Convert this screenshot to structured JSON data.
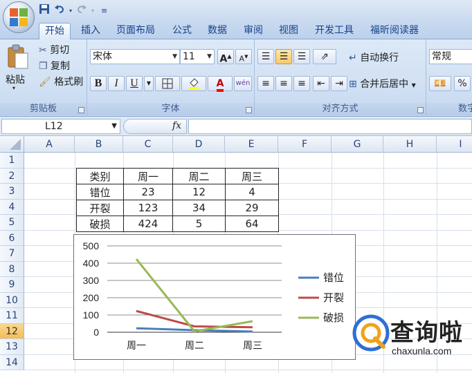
{
  "quick_access": {
    "save_icon": "save-icon",
    "undo_icon": "undo-icon",
    "redo_icon": "redo-icon"
  },
  "tabs": [
    "开始",
    "插入",
    "页面布局",
    "公式",
    "数据",
    "审阅",
    "视图",
    "开发工具",
    "福昕阅读器"
  ],
  "ribbon": {
    "clipboard": {
      "paste": "粘贴",
      "cut": "剪切",
      "copy": "复制",
      "format_painter": "格式刷",
      "label": "剪贴板"
    },
    "font": {
      "name": "宋体",
      "size": "11",
      "bold": "B",
      "italic": "I",
      "underline": "U",
      "grow": "A",
      "shrink": "A",
      "font_color": "A",
      "phonetic": "wén",
      "label": "字体"
    },
    "alignment": {
      "wrap": "自动换行",
      "merge": "合并后居中",
      "label": "对齐方式"
    },
    "number": {
      "format": "常规",
      "percent": "%",
      "label": "数字"
    }
  },
  "formula_bar": {
    "name_box": "L12",
    "fx": "fx",
    "formula": ""
  },
  "columns": [
    "A",
    "B",
    "C",
    "D",
    "E",
    "F",
    "G",
    "H",
    "I"
  ],
  "rows": [
    "1",
    "2",
    "3",
    "4",
    "5",
    "6",
    "7",
    "8",
    "9",
    "10",
    "11",
    "12",
    "13",
    "14"
  ],
  "selected_row": "12",
  "table": {
    "header": [
      "类别",
      "周一",
      "周二",
      "周三"
    ],
    "rows": [
      [
        "错位",
        "23",
        "12",
        "4"
      ],
      [
        "开裂",
        "123",
        "34",
        "29"
      ],
      [
        "破损",
        "424",
        "5",
        "64"
      ]
    ]
  },
  "chart_data": {
    "type": "line",
    "categories": [
      "周一",
      "周二",
      "周三"
    ],
    "series": [
      {
        "name": "错位",
        "values": [
          23,
          12,
          4
        ],
        "color": "#4a7ebb"
      },
      {
        "name": "开裂",
        "values": [
          123,
          34,
          29
        ],
        "color": "#be4b48"
      },
      {
        "name": "破损",
        "values": [
          424,
          5,
          64
        ],
        "color": "#98b954"
      }
    ],
    "ylim": [
      0,
      500
    ],
    "yticks": [
      0,
      100,
      200,
      300,
      400,
      500
    ],
    "grid": true,
    "legend": "right"
  },
  "watermark": {
    "title": "查询啦",
    "url": "chaxunla.com"
  }
}
